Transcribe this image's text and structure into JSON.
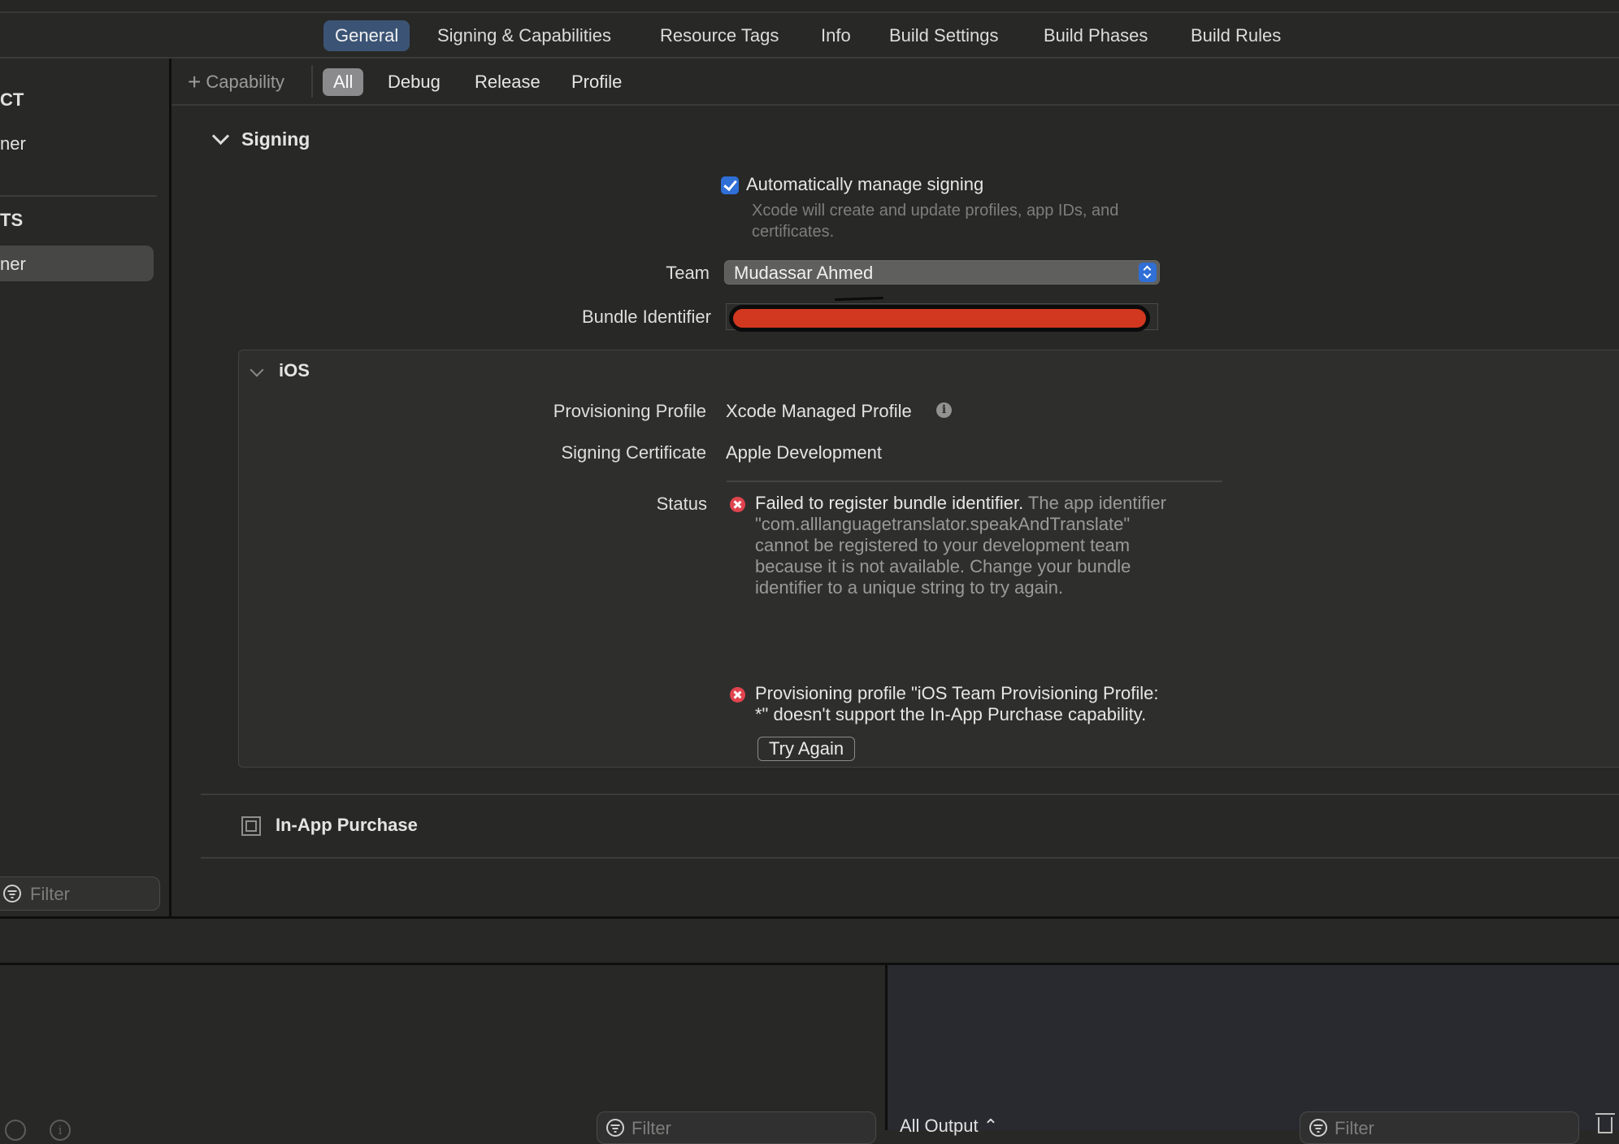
{
  "tabs": [
    {
      "label": "General",
      "active": true
    },
    {
      "label": "Signing & Capabilities",
      "active": false
    },
    {
      "label": "Resource Tags",
      "active": false
    },
    {
      "label": "Info",
      "active": false
    },
    {
      "label": "Build Settings",
      "active": false
    },
    {
      "label": "Build Phases",
      "active": false
    },
    {
      "label": "Build Rules",
      "active": false
    }
  ],
  "sidebar": {
    "project_header": "CT",
    "project_item": "ner",
    "targets_header": "TS",
    "target_item": "ner",
    "filter_placeholder": "Filter"
  },
  "subbar": {
    "add_capability": "Capability",
    "configs": [
      {
        "label": "All",
        "active": true
      },
      {
        "label": "Debug",
        "active": false
      },
      {
        "label": "Release",
        "active": false
      },
      {
        "label": "Profile",
        "active": false
      }
    ]
  },
  "signing": {
    "title": "Signing",
    "auto_manage_label": "Automatically manage signing",
    "auto_manage_checked": true,
    "auto_manage_help": "Xcode will create and update profiles, app IDs, and certificates.",
    "team_label": "Team",
    "team_value": "Mudassar Ahmed",
    "bundle_label": "Bundle Identifier",
    "bundle_value_redacted": true
  },
  "ios": {
    "title": "iOS",
    "provisioning_label": "Provisioning Profile",
    "provisioning_value": "Xcode Managed Profile",
    "certificate_label": "Signing Certificate",
    "certificate_value": "Apple Development",
    "status_label": "Status",
    "error1_bold": "Failed to register bundle identifier.",
    "error1_rest": " The app identifier \"com.alllanguagetranslator.speakAndTranslate\" cannot be registered to your development team because it is not available. Change your bundle identifier to a unique string to try again.",
    "try_again": "Try Again",
    "error2": "Provisioning profile \"iOS Team Provisioning Profile: *\" doesn't support the In-App Purchase capability."
  },
  "capabilities": [
    {
      "title": "In-App Purchase"
    }
  ],
  "debug": {
    "filter_placeholder": "Filter",
    "output_selector": "All Output ⌃",
    "console_filter_placeholder": "Filter"
  },
  "colors": {
    "accent_tab": "#3b5475",
    "checkbox_blue": "#2f6fd6",
    "error_red": "#e0444e",
    "redaction_red": "#d1381f"
  }
}
